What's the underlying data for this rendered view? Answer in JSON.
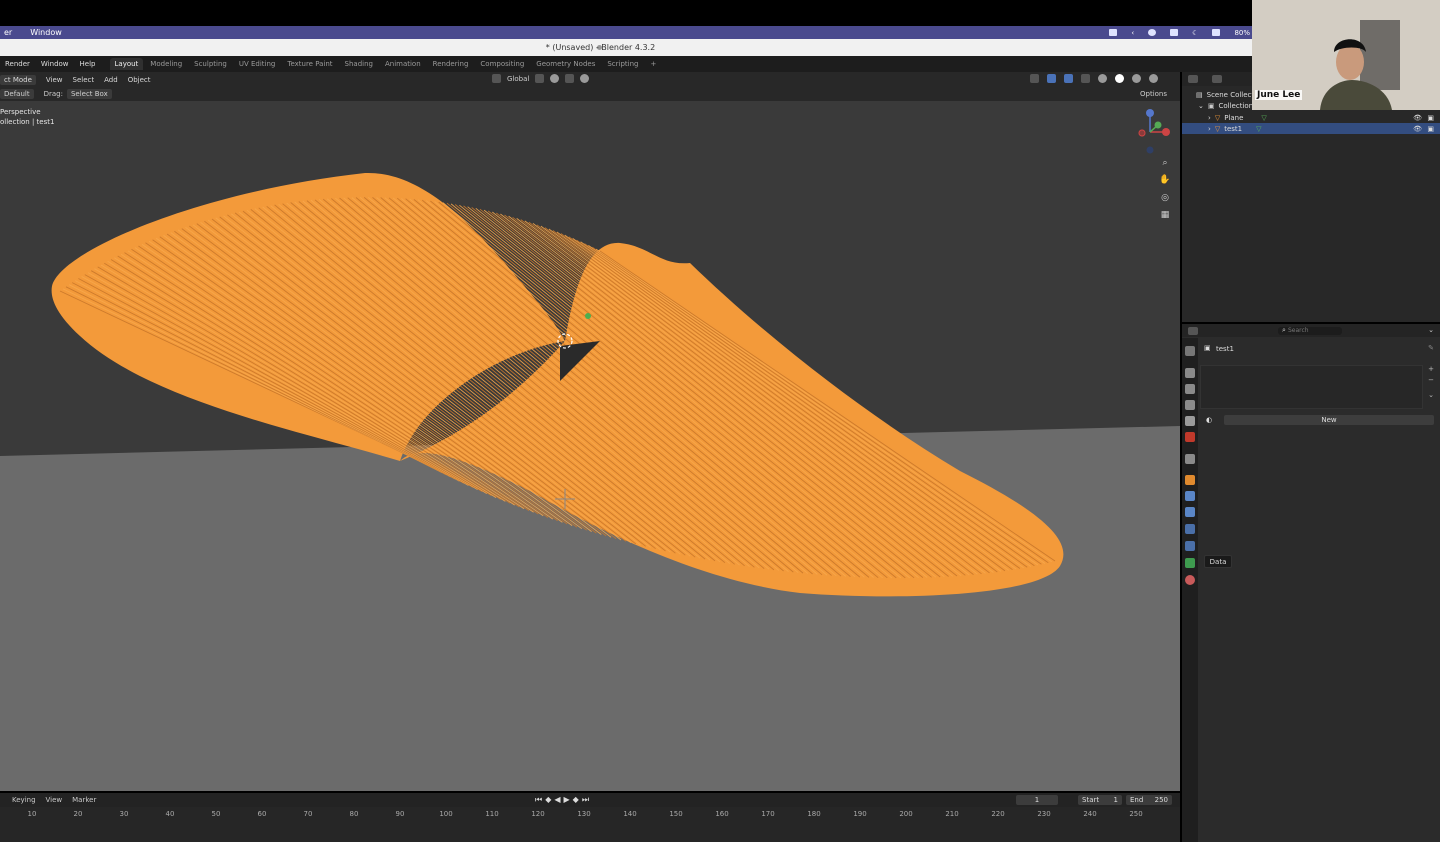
{
  "mac_menu": {
    "items": [
      "er",
      "Window"
    ],
    "battery": "80%"
  },
  "title": "* (Unsaved) - Blender 4.3.2",
  "blender_menu": {
    "items": [
      "Render",
      "Window",
      "Help"
    ]
  },
  "workspaces": [
    "Layout",
    "Modeling",
    "Sculpting",
    "UV Editing",
    "Texture Paint",
    "Shading",
    "Animation",
    "Rendering",
    "Compositing",
    "Geometry Nodes",
    "Scripting",
    "+"
  ],
  "active_workspace": "Layout",
  "viewport_header": {
    "mode": "ct Mode",
    "menus": [
      "View",
      "Select",
      "Add",
      "Object"
    ],
    "transform": "Global",
    "options": "Options"
  },
  "tool_settings": {
    "orientation": "Default",
    "drag_label": "Drag:",
    "drag_value": "Select Box"
  },
  "viewport_overlay": {
    "line1": "Perspective",
    "line2": "ollection | test1"
  },
  "outliner": {
    "header": "Scene Collectio",
    "collection": "Collection",
    "items": [
      "Plane",
      "test1"
    ]
  },
  "properties": {
    "search_placeholder": "Search",
    "object_name": "test1",
    "new_label": "New",
    "tooltip": "Data"
  },
  "timeline": {
    "menus": [
      "Keying",
      "View",
      "Marker"
    ],
    "current_frame": "1",
    "start_label": "Start",
    "start_value": "1",
    "end_label": "End",
    "end_value": "250",
    "ticks": [
      "10",
      "20",
      "30",
      "40",
      "50",
      "60",
      "70",
      "80",
      "90",
      "100",
      "110",
      "120",
      "130",
      "140",
      "150",
      "160",
      "170",
      "180",
      "190",
      "200",
      "210",
      "220",
      "230",
      "240",
      "250"
    ]
  },
  "webcam": {
    "name": "June Lee"
  },
  "colors": {
    "accent": "#f39a3a",
    "floor": "#6e6e6e",
    "world": "#3a3a3a",
    "selection": "#334d80"
  }
}
